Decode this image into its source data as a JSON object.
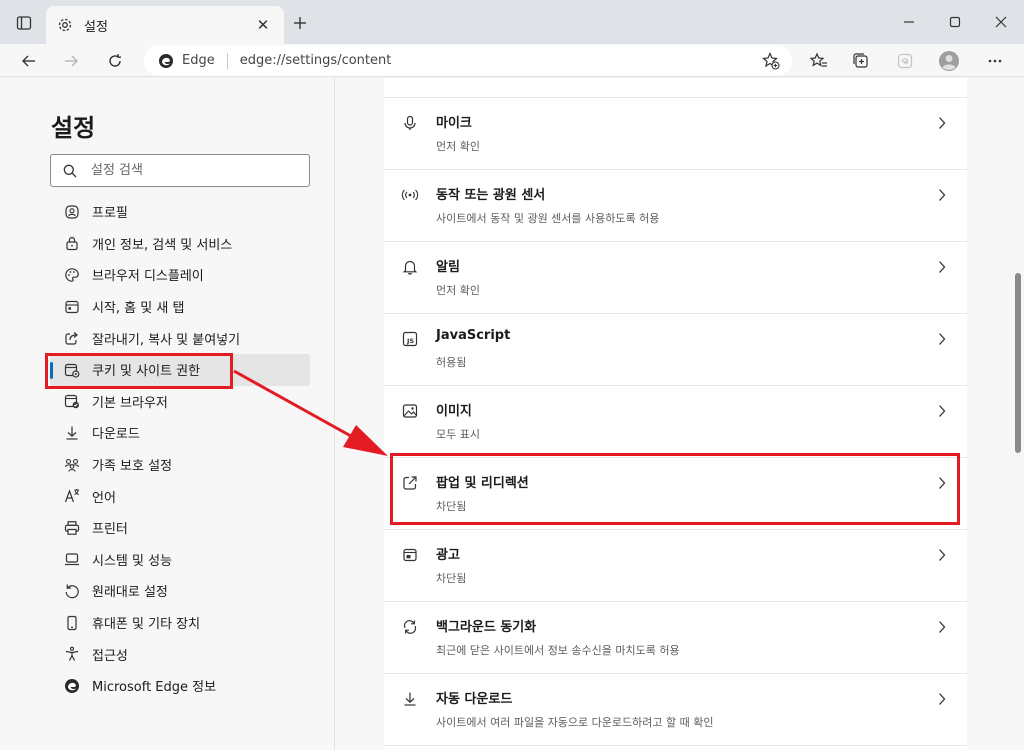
{
  "tab": {
    "title": "설정"
  },
  "address": {
    "brand": "Edge",
    "url": "edge://settings/content"
  },
  "sidebar": {
    "title": "설정",
    "search_placeholder": "설정 검색",
    "items": [
      {
        "label": "프로필",
        "icon": "profile-icon"
      },
      {
        "label": "개인 정보, 검색 및 서비스",
        "icon": "lock-icon"
      },
      {
        "label": "브라우저 디스플레이",
        "icon": "palette-icon"
      },
      {
        "label": "시작, 홈 및 새 탭",
        "icon": "home-tab-icon"
      },
      {
        "label": "잘라내기, 복사 및 붙여넣기",
        "icon": "share-icon"
      },
      {
        "label": "쿠키 및 사이트 권한",
        "icon": "cookie-permissions-icon",
        "active": true
      },
      {
        "label": "기본 브라우저",
        "icon": "default-browser-icon"
      },
      {
        "label": "다운로드",
        "icon": "download-icon"
      },
      {
        "label": "가족 보호 설정",
        "icon": "family-icon"
      },
      {
        "label": "언어",
        "icon": "language-icon"
      },
      {
        "label": "프린터",
        "icon": "printer-icon"
      },
      {
        "label": "시스템 및 성능",
        "icon": "system-icon"
      },
      {
        "label": "원래대로 설정",
        "icon": "reset-icon"
      },
      {
        "label": "휴대폰 및 기타 장치",
        "icon": "phone-icon"
      },
      {
        "label": "접근성",
        "icon": "accessibility-icon"
      },
      {
        "label": "Microsoft Edge 정보",
        "icon": "edge-icon"
      }
    ]
  },
  "permissions": [
    {
      "title": "마이크",
      "sub": "먼저 확인",
      "icon": "microphone-icon"
    },
    {
      "title": "동작 또는 광원 센서",
      "sub": "사이트에서 동작 및 광원 센서를 사용하도록 허용",
      "icon": "sensor-icon"
    },
    {
      "title": "알림",
      "sub": "먼저 확인",
      "icon": "bell-icon"
    },
    {
      "title": "JavaScript",
      "sub": "허용됨",
      "icon": "javascript-icon"
    },
    {
      "title": "이미지",
      "sub": "모두 표시",
      "icon": "image-icon"
    },
    {
      "title": "팝업 및 리디렉션",
      "sub": "차단됨",
      "icon": "popup-icon",
      "highlighted": true
    },
    {
      "title": "광고",
      "sub": "차단됨",
      "icon": "ads-icon"
    },
    {
      "title": "백그라운드 동기화",
      "sub": "최근에 닫은 사이트에서 정보 송수신을 마치도록 허용",
      "icon": "sync-icon"
    },
    {
      "title": "자동 다운로드",
      "sub": "사이트에서 여러 파일을 자동으로 다운로드하려고 할 때 확인",
      "icon": "download-icon"
    }
  ],
  "annotation_color": "#e31b23",
  "accent_color": "#0f6cbd"
}
